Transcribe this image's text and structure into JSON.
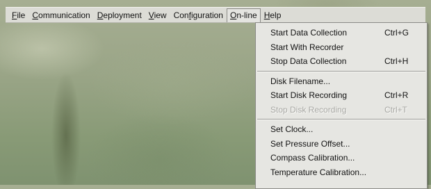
{
  "menubar": {
    "items": [
      {
        "pre": "",
        "mn": "F",
        "post": "ile"
      },
      {
        "pre": "",
        "mn": "C",
        "post": "ommunication"
      },
      {
        "pre": "",
        "mn": "D",
        "post": "eployment"
      },
      {
        "pre": "",
        "mn": "V",
        "post": "iew"
      },
      {
        "pre": "Con",
        "mn": "f",
        "post": "iguration"
      },
      {
        "pre": "",
        "mn": "O",
        "post": "n-line"
      },
      {
        "pre": "",
        "mn": "H",
        "post": "elp"
      }
    ]
  },
  "online_menu": {
    "start_data_collection": {
      "label": "Start Data Collection",
      "shortcut": "Ctrl+G"
    },
    "start_with_recorder": {
      "label": "Start With Recorder"
    },
    "stop_data_collection": {
      "label": "Stop Data Collection",
      "shortcut": "Ctrl+H"
    },
    "disk_filename": {
      "label": "Disk Filename..."
    },
    "start_disk_recording": {
      "label": "Start Disk Recording",
      "shortcut": "Ctrl+R"
    },
    "stop_disk_recording": {
      "label": "Stop Disk Recording",
      "shortcut": "Ctrl+T",
      "enabled": false
    },
    "set_clock": {
      "label": "Set Clock..."
    },
    "set_pressure_offset": {
      "label": "Set Pressure Offset..."
    },
    "compass_calibration": {
      "label": "Compass Calibration..."
    },
    "temperature_calibration": {
      "label": "Temperature Calibration..."
    }
  }
}
